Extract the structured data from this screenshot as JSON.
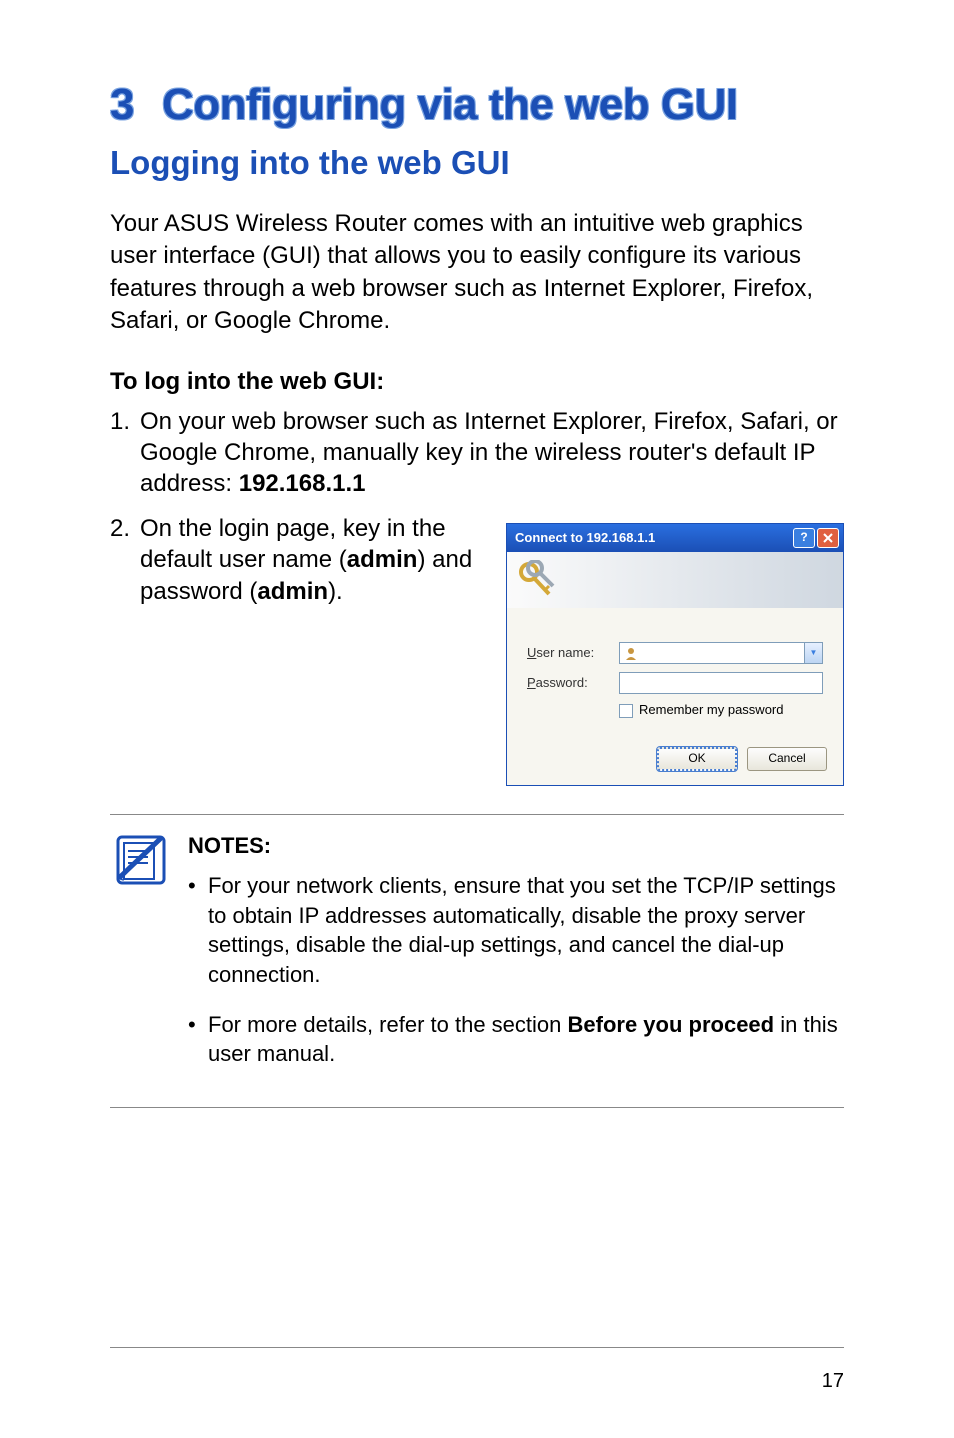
{
  "chapter": {
    "num": "3",
    "title": "Configuring via the web GUI"
  },
  "section_title": "Logging into the web GUI",
  "intro_text": "Your ASUS Wireless Router comes with an intuitive web graphics user interface (GUI) that allows you to easily configure its various features through a web browser such as Internet Explorer, Firefox, Safari, or Google Chrome.",
  "steps_heading": "To log into the web GUI:",
  "step1": {
    "text_before_ip": "On your web browser such as Internet Explorer, Firefox, Safari, or Google Chrome, manually key in the wireless router's default IP address: ",
    "ip": "192.168.1.1"
  },
  "step2": {
    "text_before_admin1": "On the login page, key in the default user name (",
    "admin1": "admin",
    "text_mid": ") and password (",
    "admin2": "admin",
    "text_end": ")."
  },
  "dialog": {
    "title": "Connect to 192.168.1.1",
    "username_label_u": "U",
    "username_label_rest": "ser name:",
    "password_label_p": "P",
    "password_label_rest": "assword:",
    "remember_r": "R",
    "remember_rest": "emember my password",
    "ok": "OK",
    "cancel": "Cancel"
  },
  "notes": {
    "title": "NOTES",
    "colon": ":",
    "item1": "For your network clients, ensure that you set the TCP/IP settings to obtain IP addresses automatically, disable the proxy server settings, disable the dial-up settings, and cancel the dial-up connection.",
    "item2_before": "For more details, refer to the section ",
    "item2_bold": "Before you proceed",
    "item2_after": " in this user manual."
  },
  "page_number": "17"
}
